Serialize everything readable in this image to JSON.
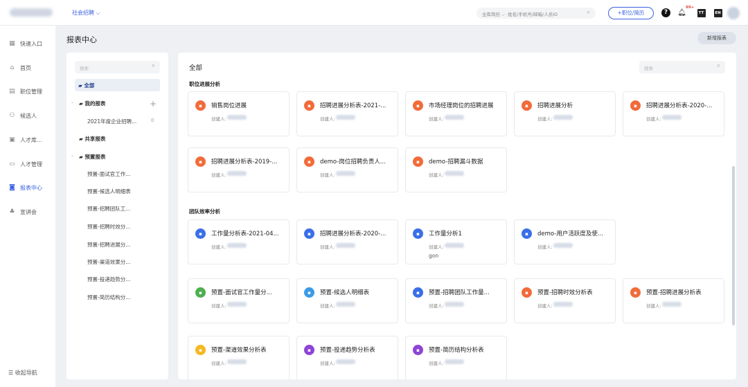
{
  "topbar": {
    "workspace": "社会招聘",
    "search_scope": "全库简历",
    "search_placeholder": "姓名/手机号/邮箱/人员ID",
    "add_button": "+职位/简历",
    "help_label": "?",
    "notice_badge": "99+",
    "doc_label": "TT",
    "en_label": "EN"
  },
  "nav": {
    "items": [
      {
        "label": "快速入口",
        "icon": "grid-icon"
      },
      {
        "label": "首页",
        "icon": "home-icon"
      },
      {
        "label": "职位管理",
        "icon": "briefcase-icon"
      },
      {
        "label": "候选人",
        "icon": "people-icon"
      },
      {
        "label": "人才库...",
        "icon": "database-icon"
      },
      {
        "label": "人才管理",
        "icon": "folder-icon"
      },
      {
        "label": "报表中心",
        "icon": "chart-icon"
      },
      {
        "label": "宣讲会",
        "icon": "meeting-icon"
      }
    ],
    "collapse": "收起导航"
  },
  "page": {
    "title": "报表中心",
    "new_report": "新增报表"
  },
  "tree": {
    "search_placeholder": "搜索",
    "all": "全部",
    "mine": "我的报表",
    "mine_child": "2021年度企业招聘...",
    "mine_child_count": "0",
    "shared": "共享报表",
    "preset": "预置报表",
    "preset_items": [
      "预置-面试官工作...",
      "预置-候选人明细表",
      "预置-招聘团队工...",
      "预置-招聘时效分...",
      "预置-招聘进展分...",
      "预置-渠道效果分...",
      "预置-投递趋势分...",
      "预置-简历结构分..."
    ]
  },
  "main": {
    "title": "全部",
    "search_placeholder": "搜索",
    "creator_label": "创建人:",
    "sections": [
      {
        "title": "职位进展分析"
      },
      {
        "title": "团队效率分析"
      }
    ],
    "cards": [
      {
        "name": "销售岗位进展",
        "color": "#f26b3a"
      },
      {
        "name": "招聘进展分析表-2021-...",
        "color": "#f26b3a"
      },
      {
        "name": "市场经理岗位的招聘进展",
        "color": "#f26b3a"
      },
      {
        "name": "招聘进展分析",
        "color": "#f26b3a"
      },
      {
        "name": "招聘进展分析表-2020-...",
        "color": "#f26b3a"
      },
      {
        "name": "招聘进展分析表-2019-...",
        "color": "#f26b3a"
      },
      {
        "name": "demo-岗位招聘负责人...",
        "color": "#f26b3a"
      },
      {
        "name": "demo-招聘漏斗数据",
        "color": "#f26b3a"
      },
      {
        "name": "工作量分析表-2021-04...",
        "color": "#3a6fe8"
      },
      {
        "name": "招聘进展分析表-2020-...",
        "color": "#3a6fe8"
      },
      {
        "name": "工作量分析1",
        "color": "#3a6fe8",
        "extra": "gon"
      },
      {
        "name": "demo-用户活跃度及使...",
        "color": "#3a6fe8"
      },
      {
        "name": "预置-面试官工作量分...",
        "color": "#4caf50"
      },
      {
        "name": "预置-候选人明细表",
        "color": "#3a9be8"
      },
      {
        "name": "预置-招聘团队工作量...",
        "color": "#3a6fe8"
      },
      {
        "name": "预置-招聘时效分析表",
        "color": "#f26b3a"
      },
      {
        "name": "预置-招聘进展分析表",
        "color": "#f26b3a"
      },
      {
        "name": "预置-渠道效果分析表",
        "color": "#f5b921"
      },
      {
        "name": "预置-投递趋势分析表",
        "color": "#8e44d6"
      },
      {
        "name": "预置-简历结构分析表",
        "color": "#8e44d6"
      }
    ]
  }
}
